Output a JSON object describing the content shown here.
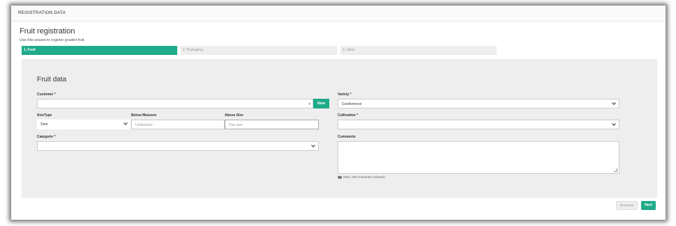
{
  "header": {
    "title": "REGISTRATION DATA"
  },
  "page": {
    "title": "Fruit registration",
    "subtitle": "Use this wizard to register graded fruit."
  },
  "steps": [
    {
      "label": "1. Fruit",
      "active": true
    },
    {
      "label": "2. Packaging",
      "active": false
    },
    {
      "label": "3. Varia",
      "active": false
    }
  ],
  "form": {
    "section_title": "Fruit data",
    "customer": {
      "label": "Customer *",
      "value": "",
      "new_button": "New"
    },
    "variety": {
      "label": "Variety *",
      "value": "Conference"
    },
    "size_type": {
      "label": "SizeType",
      "value": "Size"
    },
    "below_measure": {
      "label": "Below Measure",
      "placeholder": "Undersize"
    },
    "above_size": {
      "label": "Above Size",
      "placeholder": "Top size"
    },
    "cultivation": {
      "label": "Cultivation *",
      "value": ""
    },
    "categorie": {
      "label": "Categorie *",
      "value": ""
    },
    "comments": {
      "label": "Comments",
      "hint": "Mind: 250 characters allowed!"
    }
  },
  "nav": {
    "previous": "Previous",
    "next": "Next"
  },
  "colors": {
    "accent": "#1fab8a",
    "panel": "#eeeeee"
  }
}
